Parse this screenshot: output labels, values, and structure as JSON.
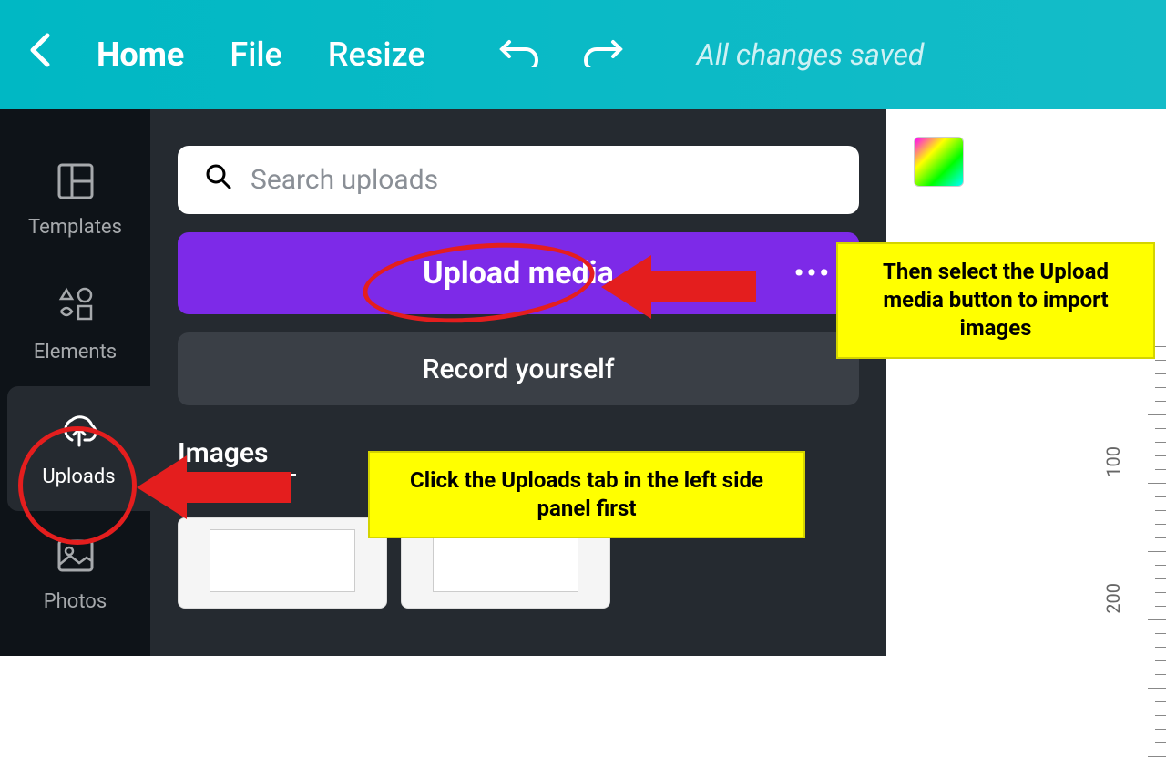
{
  "header": {
    "home": "Home",
    "file": "File",
    "resize": "Resize",
    "status": "All changes saved"
  },
  "sidebar": {
    "templates": "Templates",
    "elements": "Elements",
    "uploads": "Uploads",
    "photos": "Photos"
  },
  "panel": {
    "search_placeholder": "Search uploads",
    "upload_media": "Upload media",
    "record_yourself": "Record yourself",
    "images_tab": "Images"
  },
  "ruler": {
    "tick100": "100",
    "tick200": "200"
  },
  "annotations": {
    "callout1": "Then select the Upload media button to import images",
    "callout2": "Click the Uploads tab in the left side panel first"
  }
}
